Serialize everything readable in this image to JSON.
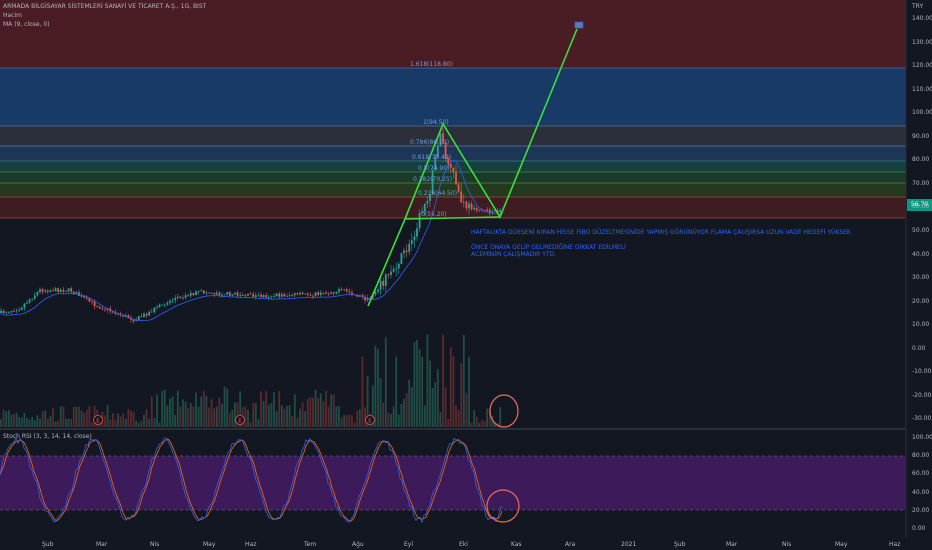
{
  "header": {
    "symbol_title": "ARMADA BİLGİSAYAR SİSTEMLERİ SANAYİ VE TİCARET A.Ş., 1G, BIST",
    "volume_label": "Hacim",
    "ma_label": "MA (9, close, 0)",
    "currency": "TRY"
  },
  "rsi": {
    "label": "Stoch RSI (3, 3, 14, 14, close)"
  },
  "price_badge": "56.70",
  "notes": {
    "line1": "HAFTALIKTA DÜEŞENİ KIRAN HİSSE FİBO DÜZELTMESİNİDE YAPMIŞ GÖRÜNÜYOR FLAMA ÇALIŞIRSA UZUN VADE HEDEFİ YÜKSEK",
    "line2": "ÖNCE ONAYA GELİP GELMEDİĞİNE DİKKAT EDİLMELİ",
    "line3": "ACEMİNİM ÇALIŞMADIR YTD."
  },
  "fib_labels": [
    "1.618(118.80)",
    "1(94.50)",
    "0.786(86.10)",
    "0.618(79.49)",
    "0.5(74.90)",
    "0.382(70.25)",
    "0.236(64.50)",
    "0(55.20)"
  ],
  "price_axis": [
    "140.00",
    "130.00",
    "120.00",
    "110.00",
    "100.00",
    "90.00",
    "80.00",
    "70.00",
    "60.00",
    "50.00",
    "40.00",
    "30.00",
    "20.00",
    "10.00",
    "0.00",
    "-10.00",
    "-20.00",
    "-30.00"
  ],
  "rsi_axis": [
    "100.00",
    "80.00",
    "60.00",
    "40.00",
    "20.00",
    "0.00"
  ],
  "time_axis": [
    "Şub",
    "Mar",
    "Nis",
    "May",
    "Haz",
    "Tem",
    "Ağu",
    "Eyl",
    "Eki",
    "Kas",
    "Ara",
    "2021",
    "Şub",
    "Mar",
    "Nis",
    "May",
    "Haz"
  ],
  "event_markers": [
    "E",
    "E",
    "E"
  ],
  "colors": {
    "up": "#26a69a",
    "down": "#ef5350",
    "ma": "#2962ff",
    "pattern": "#3cde3c",
    "rsi_k": "#2962ff",
    "rsi_d": "#ff6d00",
    "circle": "#f26b5b"
  }
}
